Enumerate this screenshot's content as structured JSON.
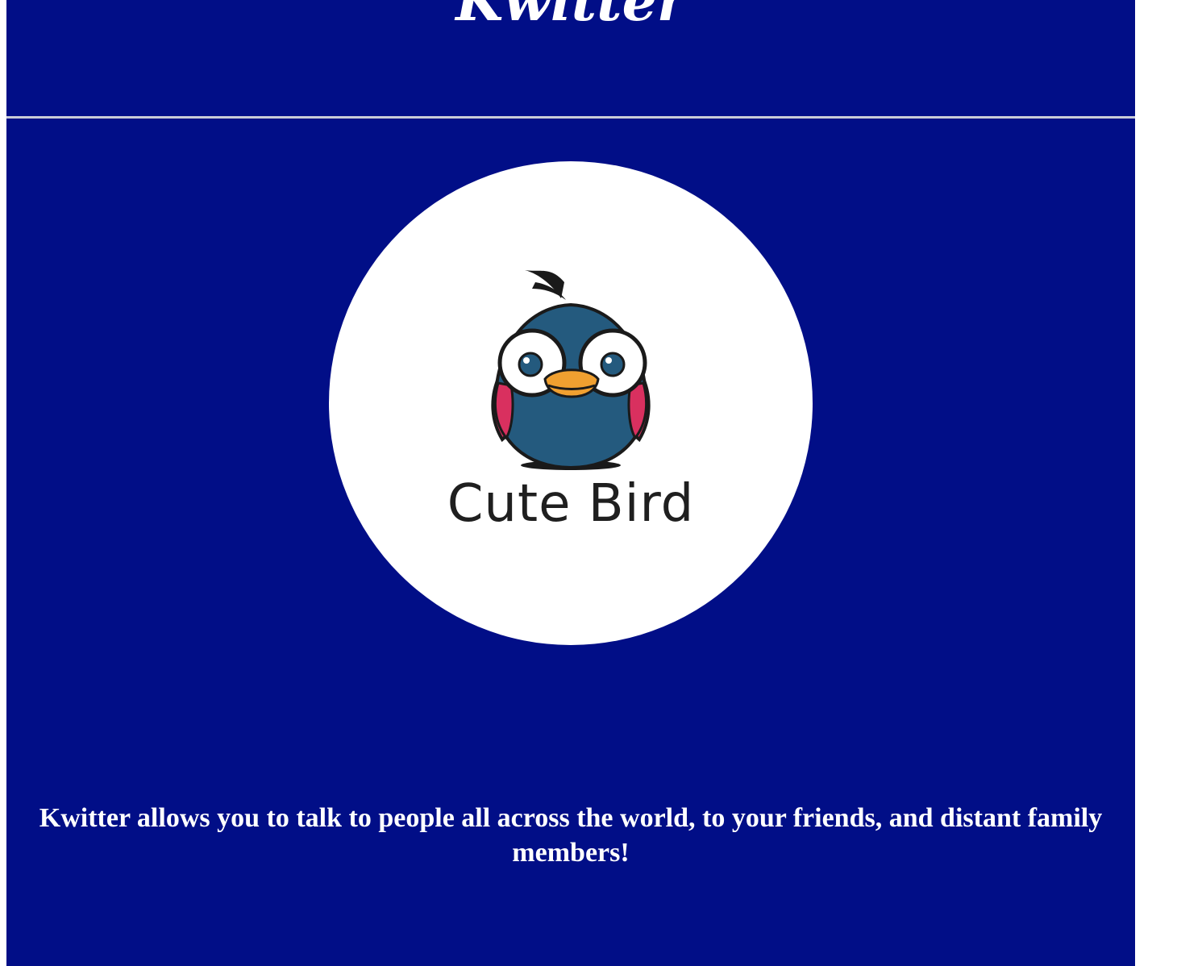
{
  "header": {
    "title": "Kwitter"
  },
  "logo": {
    "icon": "cute-bird-icon",
    "label": "Cute Bird",
    "colors": {
      "background": "#ffffff",
      "body": "#245a7e",
      "beak": "#f0a030",
      "cheeks": "#d9305f"
    }
  },
  "main": {
    "tagline": "Kwitter allows you to talk to people all across the world, to your friends, and distant family members!"
  },
  "theme": {
    "page_background": "#010e87",
    "text_color": "#ffffff"
  }
}
